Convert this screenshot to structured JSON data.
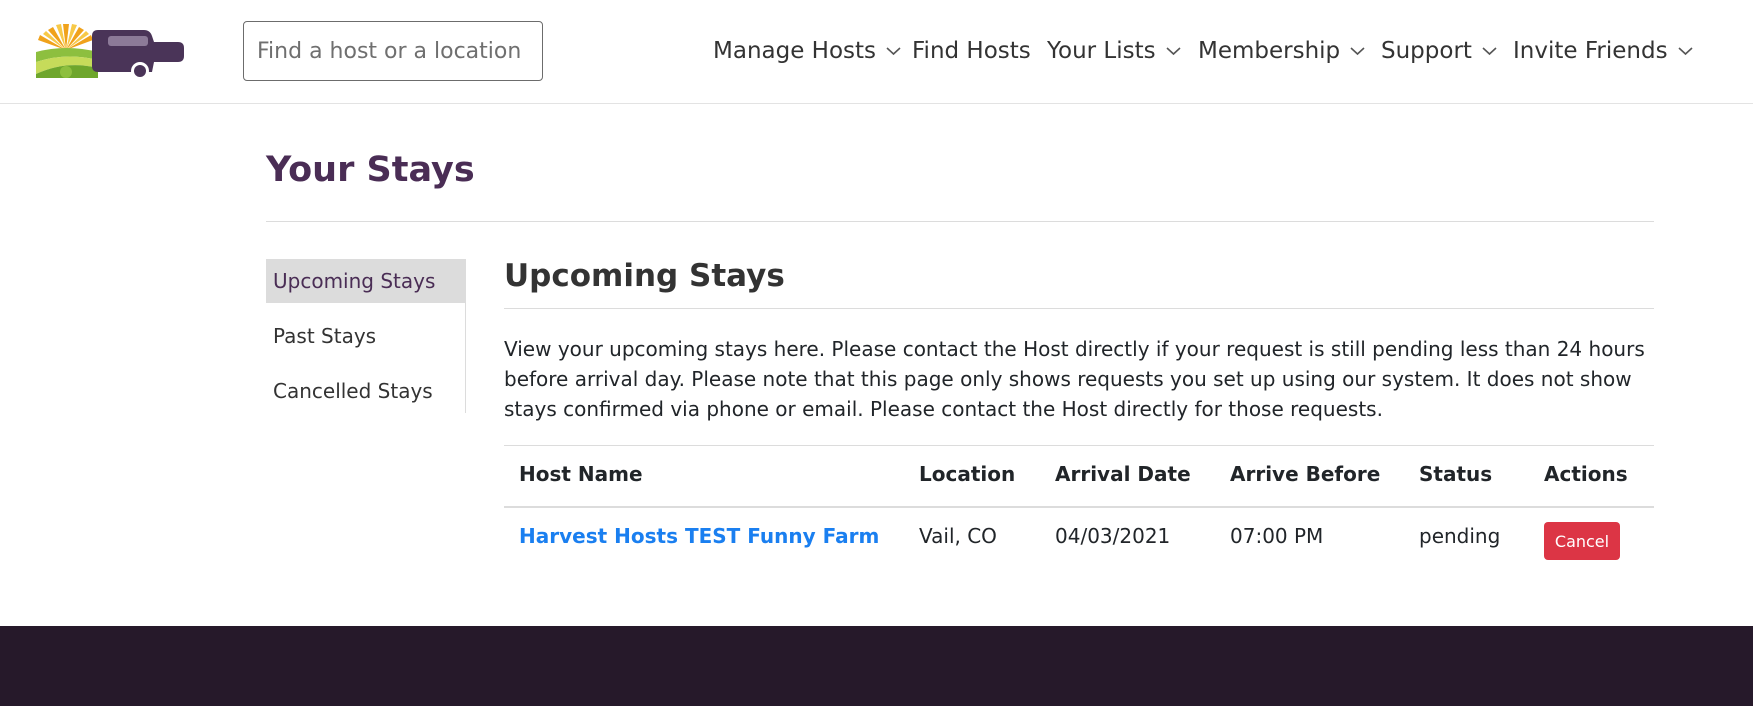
{
  "header": {
    "search_placeholder": "Find a host or a location",
    "nav": [
      {
        "label": "Manage Hosts",
        "has_dropdown": true
      },
      {
        "label": "Find Hosts",
        "has_dropdown": false
      },
      {
        "label": "Your Lists",
        "has_dropdown": true
      },
      {
        "label": "Membership",
        "has_dropdown": true
      },
      {
        "label": "Support",
        "has_dropdown": true
      },
      {
        "label": "Invite Friends",
        "has_dropdown": true
      }
    ]
  },
  "main": {
    "page_title": "Your Stays",
    "sidebar": {
      "items": [
        {
          "label": "Upcoming Stays",
          "active": true
        },
        {
          "label": "Past Stays",
          "active": false
        },
        {
          "label": "Cancelled Stays",
          "active": false
        }
      ]
    },
    "section_title": "Upcoming Stays",
    "intro": "View your upcoming stays here. Please contact the Host directly if your request is still pending less than 24 hours before arrival day. Please note that this page only shows requests you set up using our system. It does not show stays confirmed via phone or email. Please contact the Host directly for those requests.",
    "table": {
      "headers": [
        "Host Name",
        "Location",
        "Arrival Date",
        "Arrive Before",
        "Status",
        "Actions"
      ],
      "rows": [
        {
          "host_name": "Harvest Hosts TEST Funny Farm",
          "location": "Vail, CO",
          "arrival_date": "04/03/2021",
          "arrive_before": "07:00 PM",
          "status": "pending",
          "action_label": "Cancel"
        }
      ]
    }
  },
  "colors": {
    "brand_purple": "#4a2d55",
    "link_blue": "#1a7ff0",
    "cancel_red": "#dc3545",
    "footer_bg": "#26192a"
  }
}
